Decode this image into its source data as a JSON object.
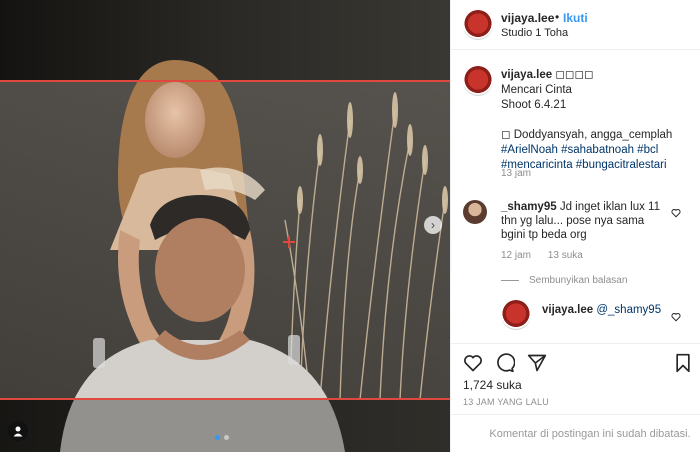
{
  "media": {
    "next_glyph": "›",
    "carousel_dots": 2,
    "active_dot": 0
  },
  "header": {
    "username": "vijaya.lee",
    "separator": "•",
    "follow_label": "Ikuti",
    "location": "Studio 1 Toha"
  },
  "caption": {
    "username": "vijaya.lee",
    "user_suffix": "◻◻◻◻",
    "line1": "Mencari Cinta",
    "line2": "Shoot 6.4.21",
    "line3": "◻ Doddyansyah, angga_cemplah",
    "tags1": "#ArielNoah #sahabatnoah #bcl",
    "tags2": "#mencaricinta #bungacitralestari",
    "time": "13 jam"
  },
  "comments": [
    {
      "username": "_shamy95",
      "text": "Jd inget iklan lux 11 thn yg lalu... pose nya sama bgini tp beda org",
      "time": "12 jam",
      "likes": "13 suka"
    }
  ],
  "hide_replies_label": "Sembunyikan balasan",
  "reply": {
    "username": "vijaya.lee",
    "mention": "@_shamy95"
  },
  "actions": {
    "likes": "1,724 suka",
    "when": "13 JAM YANG LALU",
    "comments_disabled": "Komentar di postingan ini sudah dibatasi."
  },
  "colors": {
    "accent": "#3897f0",
    "frame_red": "#e0483f",
    "muted": "#8e8e8e"
  }
}
